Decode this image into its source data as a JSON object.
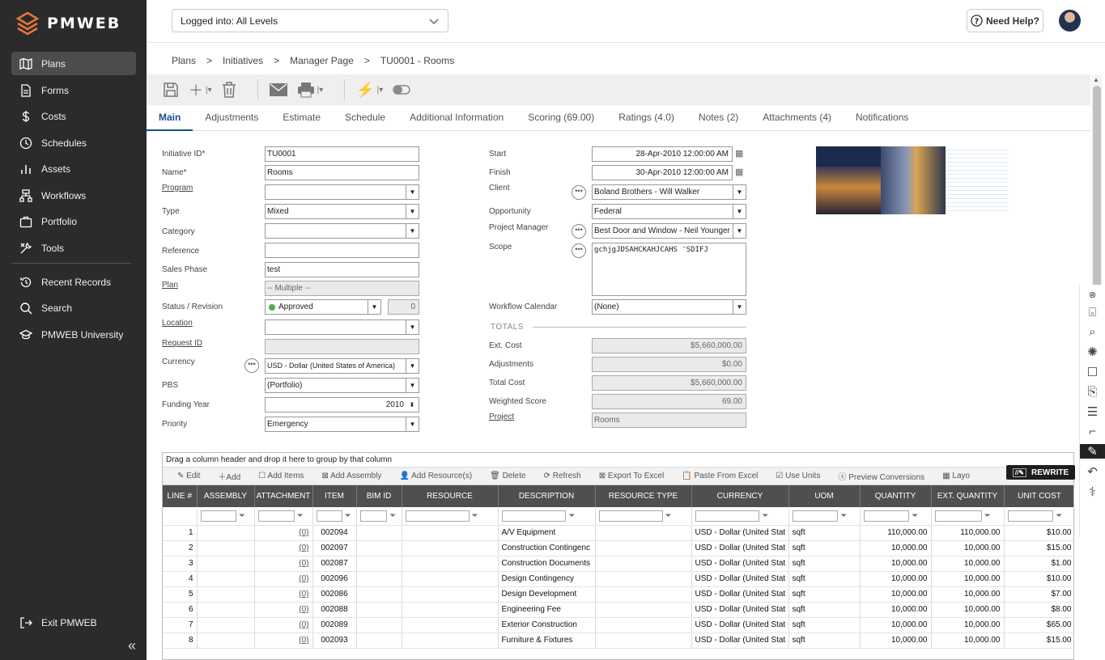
{
  "app": {
    "brand": "PMWEB"
  },
  "sidebar": {
    "items": [
      {
        "label": "Plans",
        "icon": "map-icon"
      },
      {
        "label": "Forms",
        "icon": "file-icon"
      },
      {
        "label": "Costs",
        "icon": "dollar-icon"
      },
      {
        "label": "Schedules",
        "icon": "clock-icon"
      },
      {
        "label": "Assets",
        "icon": "bars-icon"
      },
      {
        "label": "Workflows",
        "icon": "workflow-icon"
      },
      {
        "label": "Portfolio",
        "icon": "briefcase-icon"
      },
      {
        "label": "Tools",
        "icon": "tools-icon"
      }
    ],
    "secondary": [
      {
        "label": "Recent Records"
      },
      {
        "label": "Search"
      },
      {
        "label": "PMWEB University"
      }
    ],
    "exit_label": "Exit PMWEB",
    "collapse_glyph": "«"
  },
  "header": {
    "level_select": "Logged into: All Levels",
    "help_label": "Need Help?"
  },
  "breadcrumb": [
    "Plans",
    "Initiatives",
    "Manager Page",
    "TU0001 - Rooms"
  ],
  "tabs": [
    "Main",
    "Adjustments",
    "Estimate",
    "Schedule",
    "Additional Information",
    "Scoring (69.00)",
    "Ratings (4.0)",
    "Notes (2)",
    "Attachments (4)",
    "Notifications"
  ],
  "form": {
    "initiative_id_label": "Initiative ID*",
    "initiative_id": "TU0001",
    "name_label": "Name*",
    "name": "Rooms",
    "program_label": "Program",
    "program": "",
    "type_label": "Type",
    "type": "Mixed",
    "category_label": "Category",
    "category": "",
    "reference_label": "Reference",
    "reference": "",
    "sales_phase_label": "Sales Phase",
    "sales_phase": "test",
    "plan_label": "Plan",
    "plan": "-- Multiple --",
    "status_label": "Status / Revision",
    "status": "Approved",
    "revision": "0",
    "location_label": "Location",
    "location": "",
    "request_id_label": "Request ID",
    "request_id": "",
    "currency_label": "Currency",
    "currency": "USD - Dollar (United States of America)",
    "pbs_label": "PBS",
    "pbs": "(Portfolio)",
    "funding_year_label": "Funding Year",
    "funding_year": "2010",
    "priority_label": "Priority",
    "priority": "Emergency",
    "start_label": "Start",
    "start": "28-Apr-2010 12:00:00 AM",
    "finish_label": "Finish",
    "finish": "30-Apr-2010 12:00:00 AM",
    "client_label": "Client",
    "client": "Boland Brothers - Will Walker",
    "opportunity_label": "Opportunity",
    "opportunity": "Federal",
    "pm_label": "Project Manager",
    "pm": "Best Door and Window - Neil Younger",
    "scope_label": "Scope",
    "scope": "gchjgJDSAHCKAHJCAHS  'SDIFJ",
    "wf_calendar_label": "Workflow Calendar",
    "wf_calendar": "(None)",
    "totals_label": "TOTALS",
    "ext_cost_label": "Ext. Cost",
    "ext_cost": "$5,660,000.00",
    "adjustments_label": "Adjustments",
    "adjustments": "$0.00",
    "total_cost_label": "Total Cost",
    "total_cost": "$5,660,000.00",
    "weighted_score_label": "Weighted Score",
    "weighted_score": "69.00",
    "project_label": "Project",
    "project": "Rooms"
  },
  "grid": {
    "group_hint": "Drag a column header and drop it here to group by that column",
    "tools": [
      "Edit",
      "Add",
      "Add Items",
      "Add Assembly",
      "Add Resource(s)",
      "Delete",
      "Refresh",
      "Export To Excel",
      "Paste From Excel",
      "Use Units",
      "Preview Conversions",
      "Layo"
    ],
    "columns": [
      "LINE #",
      "ASSEMBLY",
      "ATTACHMENT",
      "ITEM",
      "BIM ID",
      "RESOURCE",
      "DESCRIPTION",
      "RESOURCE TYPE",
      "CURRENCY",
      "UOM",
      "QUANTITY",
      "EXT. QUANTITY",
      "UNIT COST"
    ],
    "rows": [
      [
        "1",
        "",
        "(0)",
        "002094",
        "",
        "",
        "A/V Equipment",
        "",
        "USD - Dollar (United Stat",
        "sqft",
        "110,000.00",
        "110,000.00",
        "$10.00"
      ],
      [
        "2",
        "",
        "(0)",
        "002097",
        "",
        "",
        "Construction Contingenc",
        "",
        "USD - Dollar (United Stat",
        "sqft",
        "10,000.00",
        "10,000.00",
        "$15.00"
      ],
      [
        "3",
        "",
        "(0)",
        "002087",
        "",
        "",
        "Construction Documents",
        "",
        "USD - Dollar (United Stat",
        "sqft",
        "10,000.00",
        "10,000.00",
        "$1.00"
      ],
      [
        "4",
        "",
        "(0)",
        "002096",
        "",
        "",
        "Design Contingency",
        "",
        "USD - Dollar (United Stat",
        "sqft",
        "10,000.00",
        "10,000.00",
        "$10.00"
      ],
      [
        "5",
        "",
        "(0)",
        "002086",
        "",
        "",
        "Design Development",
        "",
        "USD - Dollar (United Stat",
        "sqft",
        "10,000.00",
        "10,000.00",
        "$7.00"
      ],
      [
        "6",
        "",
        "(0)",
        "002088",
        "",
        "",
        "Engineering Fee",
        "",
        "USD - Dollar (United Stat",
        "sqft",
        "10,000.00",
        "10,000.00",
        "$8.00"
      ],
      [
        "7",
        "",
        "(0)",
        "002089",
        "",
        "",
        "Exterior Construction",
        "",
        "USD - Dollar (United Stat",
        "sqft",
        "10,000.00",
        "10,000.00",
        "$65.00"
      ],
      [
        "8",
        "",
        "(0)",
        "002093",
        "",
        "",
        "Furniture & Fixtures",
        "",
        "USD - Dollar (United Stat",
        "sqft",
        "10,000.00",
        "10,000.00",
        "$15.00"
      ]
    ]
  },
  "rewrite_label": "REWRITE"
}
